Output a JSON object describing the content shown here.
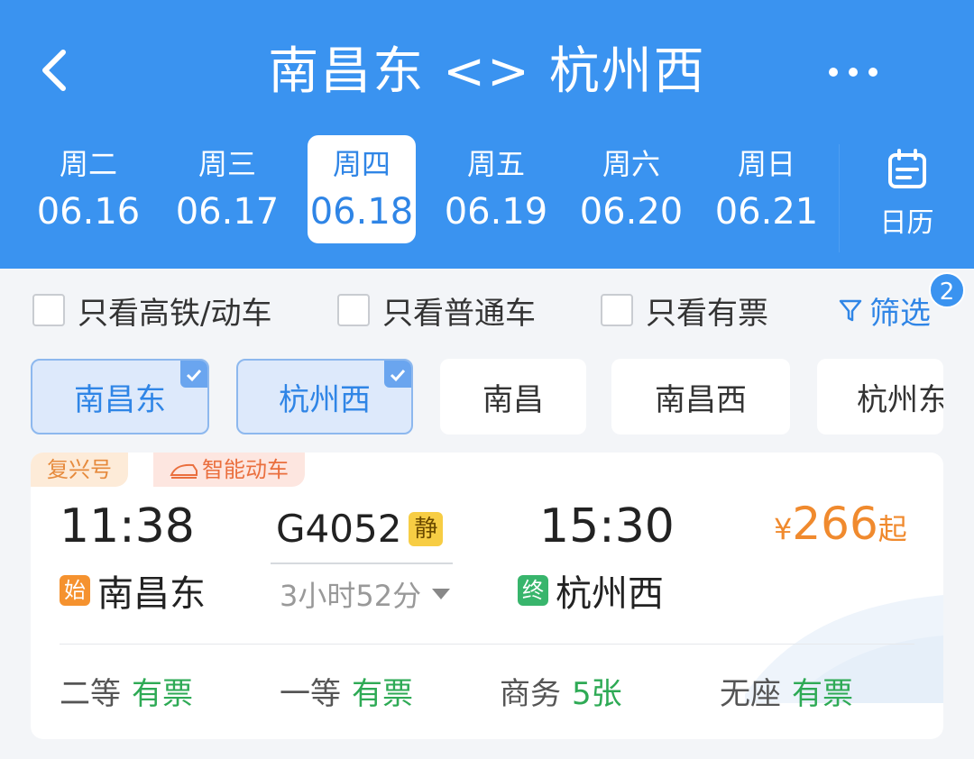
{
  "header": {
    "title": "南昌东 <> 杭州西",
    "back_icon": "chevron-left-icon",
    "more_icon": "more-dots-icon",
    "color": "#3a93f0"
  },
  "dates": [
    {
      "weekday": "周二",
      "date": "06.16",
      "active": false
    },
    {
      "weekday": "周三",
      "date": "06.17",
      "active": false
    },
    {
      "weekday": "周四",
      "date": "06.18",
      "active": true
    },
    {
      "weekday": "周五",
      "date": "06.19",
      "active": false
    },
    {
      "weekday": "周六",
      "date": "06.20",
      "active": false
    },
    {
      "weekday": "周日",
      "date": "06.21",
      "active": false
    }
  ],
  "calendar": {
    "label": "日历",
    "icon": "calendar-icon"
  },
  "filters": {
    "high_speed": "只看高铁/动车",
    "normal": "只看普通车",
    "available": "只看有票",
    "filter_label": "筛选",
    "filter_icon": "funnel-icon",
    "filter_count": "2"
  },
  "stations": [
    {
      "name": "南昌东",
      "selected": true
    },
    {
      "name": "杭州西",
      "selected": true
    },
    {
      "name": "南昌",
      "selected": false
    },
    {
      "name": "南昌西",
      "selected": false
    },
    {
      "name": "杭州东",
      "selected": false
    }
  ],
  "train": {
    "tags": [
      "复兴号",
      "智能动车"
    ],
    "dep_time": "11:38",
    "arr_time": "15:30",
    "number": "G4052",
    "quiet_badge": "静",
    "duration": "3小时52分",
    "price_currency": "¥",
    "price_value": "266",
    "price_suffix": "起",
    "dep_badge": "始",
    "dep_station": "南昌东",
    "arr_badge": "终",
    "arr_station": "杭州西",
    "seats": [
      {
        "class": "二等",
        "status": "有票"
      },
      {
        "class": "一等",
        "status": "有票"
      },
      {
        "class": "商务",
        "status": "5张"
      },
      {
        "class": "无座",
        "status": "有票"
      }
    ],
    "price_color": "#f08a2e",
    "available_color": "#2eaa55"
  }
}
